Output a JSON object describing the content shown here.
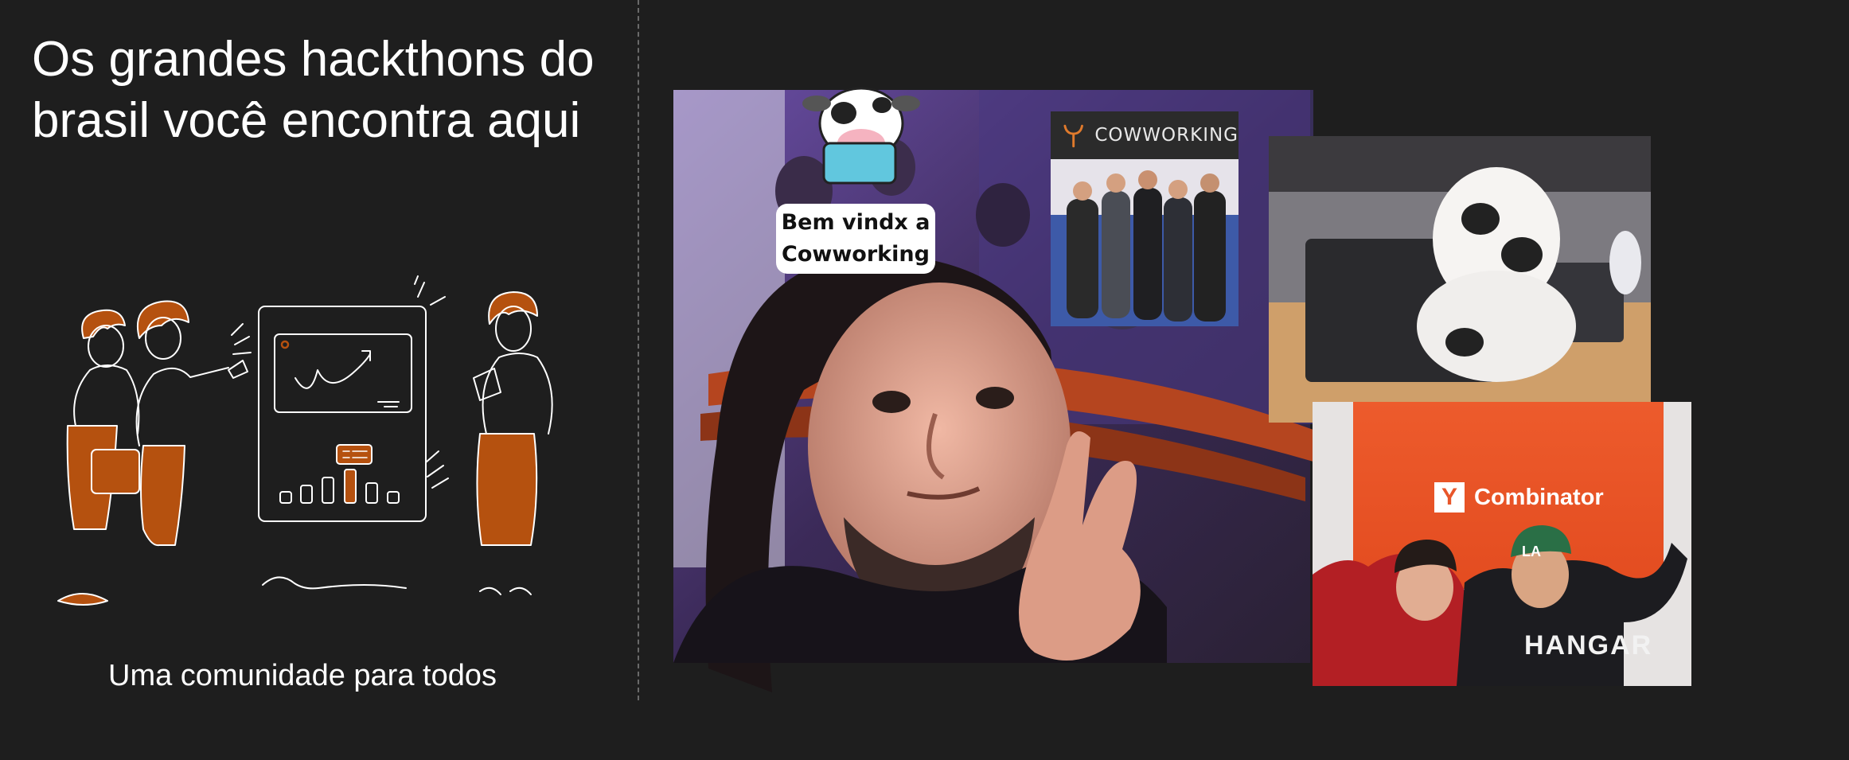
{
  "slide": {
    "headline": "Os grandes hackthons do brasil você encontra aqui",
    "tagline": "Uma comunidade para todos"
  },
  "collage": {
    "sticker_text_line1": "Bem vindx a",
    "sticker_text_line2": "Cowworking",
    "coworking_logo_text": "COWWORKING",
    "yc_logo_letter": "Y",
    "yc_logo_text": "Combinator",
    "hoodie_text": "HANGAR",
    "cap_text": "LA"
  },
  "colors": {
    "background": "#1e1e1e",
    "accent_orange": "#b5510f",
    "text": "#ffffff",
    "yc_orange": "#e8562a"
  },
  "icons": [
    "cow-mascot-icon",
    "coworking-logo-icon",
    "y-combinator-logo"
  ]
}
